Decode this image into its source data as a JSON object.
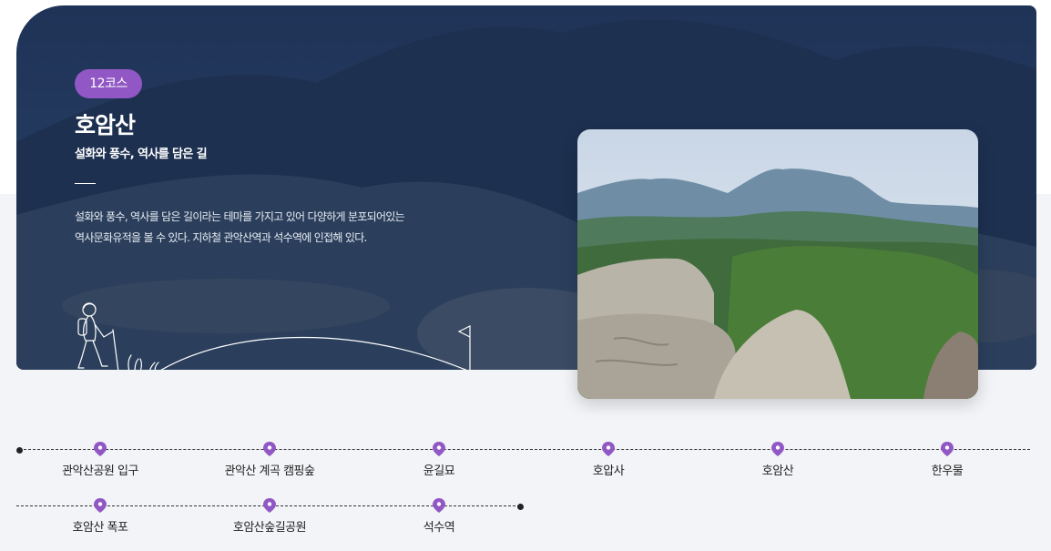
{
  "course": {
    "badge": "12코스",
    "title": "호암산",
    "subtitle": "설화와 풍수, 역사를 담은 길",
    "description_line1": "설화와 풍수, 역사를 담은 길이라는 테마를 가지고 있어 다양하게 분포되어있는",
    "description_line2": "역사문화유적을 볼 수 있다. 지하철 관악산역과 석수역에 인접해 있다."
  },
  "route": {
    "row1": [
      {
        "label": "관악산공원 입구"
      },
      {
        "label": "관악산 계곡 캠핑숲"
      },
      {
        "label": "윤길묘"
      },
      {
        "label": "호압사"
      },
      {
        "label": "호암산"
      },
      {
        "label": "한우물"
      }
    ],
    "row2": [
      {
        "label": "호암산 폭포"
      },
      {
        "label": "호암산숲길공원"
      },
      {
        "label": "석수역"
      }
    ]
  },
  "colors": {
    "accent": "#9158c5",
    "hero_overlay": "#233a5e",
    "lower_background": "#f2f4f7"
  },
  "icons": {
    "pin": "map-pin-icon",
    "hiker": "hiker-illustration"
  }
}
